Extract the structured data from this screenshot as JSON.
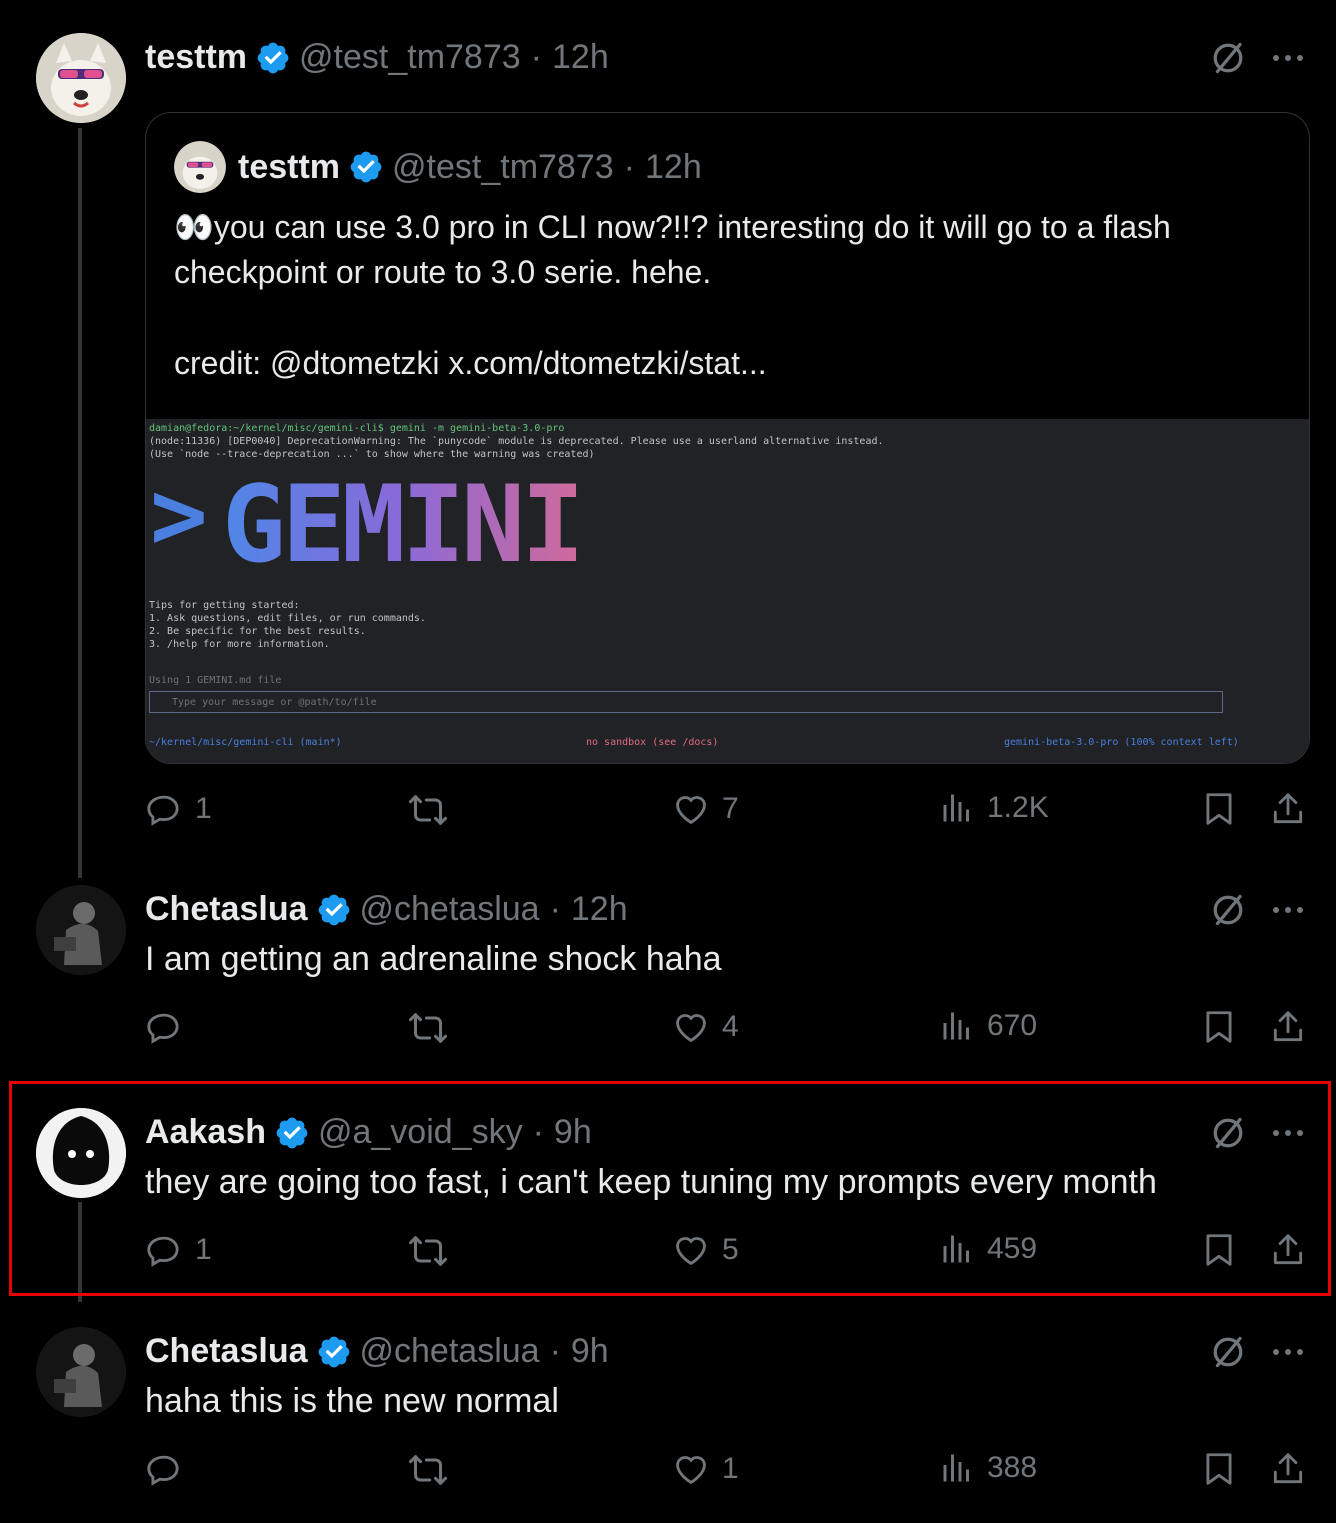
{
  "colors": {
    "background": "#000000",
    "text": "#e7e9ea",
    "muted": "#71767b",
    "verified": "#1d9bf0",
    "highlight": "#e60000"
  },
  "tweets": [
    {
      "name": "testtm",
      "handle": "@test_tm7873",
      "time": "12h",
      "quote": {
        "name": "testtm",
        "handle": "@test_tm7873",
        "time": "12h",
        "line1": "👀you can use 3.0 pro in CLI now?!!? interesting do it will go to a flash",
        "line2": "checkpoint or route to 3.0 serie. hehe.",
        "line3": "credit: @dtometzki  x.com/dtometzki/stat...",
        "terminal": {
          "prompt_line": "damian@fedora:~/kernel/misc/gemini-cli$ gemini -m gemini-beta-3.0-pro",
          "warn_line1": "(node:11336) [DEP0040] DeprecationWarning: The `punycode` module is deprecated. Please use a userland alternative instead.",
          "warn_line2": "(Use `node --trace-deprecation ...` to show where the warning was created)",
          "logo": "GEMINI",
          "tips_title": "Tips for getting started:",
          "tip1": "1. Ask questions, edit files, or run commands.",
          "tip2": "2. Be specific for the best results.",
          "tip3": "3. /help for more information.",
          "using": "Using 1 GEMINI.md file",
          "input_placeholder": "Type your message or @path/to/file",
          "status_left": "~/kernel/misc/gemini-cli (main*)",
          "status_mid": "no sandbox (see /docs)",
          "status_right": "gemini-beta-3.0-pro (100% context left)"
        }
      },
      "replies": "1",
      "reposts": "",
      "likes": "7",
      "views": "1.2K"
    },
    {
      "name": "Chetaslua",
      "handle": "@chetaslua",
      "time": "12h",
      "text": "I am getting an adrenaline shock haha",
      "replies": "",
      "reposts": "",
      "likes": "4",
      "views": "670"
    },
    {
      "name": "Aakash",
      "handle": "@a_void_sky",
      "time": "9h",
      "text": "they are going too fast, i can't keep tuning my prompts every month",
      "replies": "1",
      "reposts": "",
      "likes": "5",
      "views": "459"
    },
    {
      "name": "Chetaslua",
      "handle": "@chetaslua",
      "time": "9h",
      "text": "haha this is the new normal",
      "replies": "",
      "reposts": "",
      "likes": "1",
      "views": "388"
    }
  ]
}
